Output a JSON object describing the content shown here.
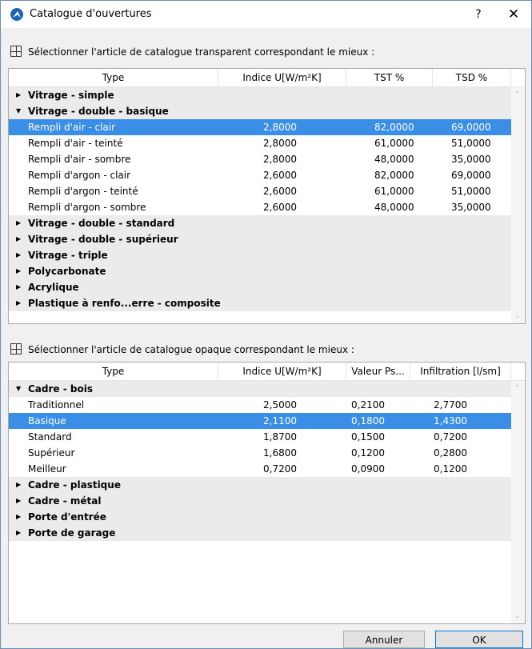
{
  "window": {
    "title": "Catalogue d'ouvertures",
    "help": "?",
    "close": "✕"
  },
  "transparent": {
    "label": "Sélectionner l'article de catalogue transparent correspondant le mieux :",
    "headers": [
      "Type",
      "Indice U[W/m²K]",
      "TST %",
      "TSD %"
    ],
    "rows": [
      {
        "kind": "group",
        "expanded": false,
        "label": "Vitrage - simple"
      },
      {
        "kind": "group",
        "expanded": true,
        "label": "Vitrage - double - basique"
      },
      {
        "kind": "item",
        "selected": true,
        "cells": [
          "Rempli d'air - clair",
          "2,8000",
          "82,0000",
          "69,0000"
        ]
      },
      {
        "kind": "item",
        "cells": [
          "Rempli d'air - teinté",
          "2,8000",
          "61,0000",
          "51,0000"
        ]
      },
      {
        "kind": "item",
        "cells": [
          "Rempli d'air - sombre",
          "2,8000",
          "48,0000",
          "35,0000"
        ]
      },
      {
        "kind": "item",
        "cells": [
          "Rempli d'argon - clair",
          "2,6000",
          "82,0000",
          "69,0000"
        ]
      },
      {
        "kind": "item",
        "cells": [
          "Rempli d'argon - teinté",
          "2,6000",
          "61,0000",
          "51,0000"
        ]
      },
      {
        "kind": "item",
        "cells": [
          "Rempli d'argon - sombre",
          "2,6000",
          "48,0000",
          "35,0000"
        ]
      },
      {
        "kind": "group",
        "expanded": false,
        "label": "Vitrage - double - standard"
      },
      {
        "kind": "group",
        "expanded": false,
        "label": "Vitrage - double - supérieur"
      },
      {
        "kind": "group",
        "expanded": false,
        "label": "Vitrage - triple"
      },
      {
        "kind": "group",
        "expanded": false,
        "label": "Polycarbonate"
      },
      {
        "kind": "group",
        "expanded": false,
        "label": "Acrylique"
      },
      {
        "kind": "group",
        "expanded": false,
        "label": "Plastique à renfo...erre - composite"
      }
    ]
  },
  "opaque": {
    "label": "Sélectionner l'article de catalogue opaque correspondant le mieux :",
    "headers": [
      "Type",
      "Indice U[W/m²K]",
      "Valeur Ps...",
      "Infiltration [l/sm]"
    ],
    "rows": [
      {
        "kind": "group",
        "expanded": true,
        "label": "Cadre - bois"
      },
      {
        "kind": "item",
        "cells": [
          "Traditionnel",
          "2,5000",
          "0,2100",
          "2,7700"
        ]
      },
      {
        "kind": "item",
        "selected": true,
        "cells": [
          "Basique",
          "2,1100",
          "0,1800",
          "1,4300"
        ]
      },
      {
        "kind": "item",
        "cells": [
          "Standard",
          "1,8700",
          "0,1500",
          "0,7200"
        ]
      },
      {
        "kind": "item",
        "cells": [
          "Supérieur",
          "1,6800",
          "0,1200",
          "0,2800"
        ]
      },
      {
        "kind": "item",
        "cells": [
          "Meilleur",
          "0,7200",
          "0,0900",
          "0,1200"
        ]
      },
      {
        "kind": "group",
        "expanded": false,
        "label": "Cadre - plastique"
      },
      {
        "kind": "group",
        "expanded": false,
        "label": "Cadre - métal"
      },
      {
        "kind": "group",
        "expanded": false,
        "label": "Porte d'entrée"
      },
      {
        "kind": "group",
        "expanded": false,
        "label": "Porte de garage"
      }
    ]
  },
  "buttons": {
    "cancel": "Annuler",
    "ok": "OK"
  },
  "colors": {
    "selection": "#3a8ee6",
    "group_row": "#ebebeb"
  }
}
